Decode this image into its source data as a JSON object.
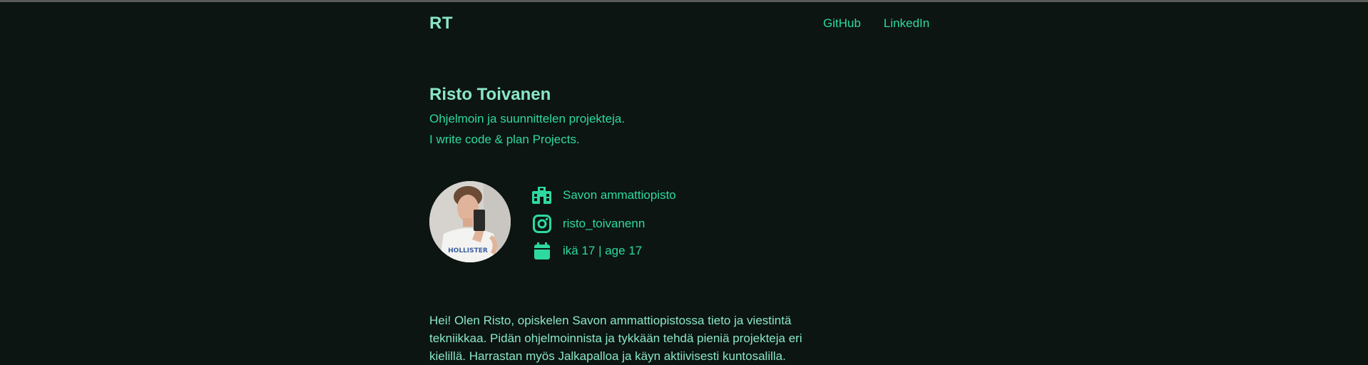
{
  "header": {
    "logo": "RT",
    "nav": [
      {
        "label": "GitHub"
      },
      {
        "label": "LinkedIn"
      }
    ]
  },
  "profile": {
    "name": "Risto Toivanen",
    "tagline_fi": "Ohjelmoin ja suunnittelen projekteja.",
    "tagline_en": "I write code & plan Projects."
  },
  "info": {
    "school": {
      "icon": "school-icon",
      "text": "Savon ammattiopisto"
    },
    "instagram": {
      "icon": "instagram-icon",
      "text": "risto_toivanenn"
    },
    "age": {
      "icon": "calendar-icon",
      "text": "ikä 17 | age 17"
    }
  },
  "bio": {
    "text": "Hei! Olen Risto, opiskelen Savon ammattiopistossa tieto ja viestintä tekniikkaa. Pidän ohjelmoinnista ja tykkään tehdä pieniä projekteja eri kielillä. Harrastan myös Jalkapalloa ja käyn aktiivisesti kuntosalilla."
  },
  "colors": {
    "background": "#0c1511",
    "accent": "#2ed9a0",
    "heading": "#8ae6c8"
  }
}
